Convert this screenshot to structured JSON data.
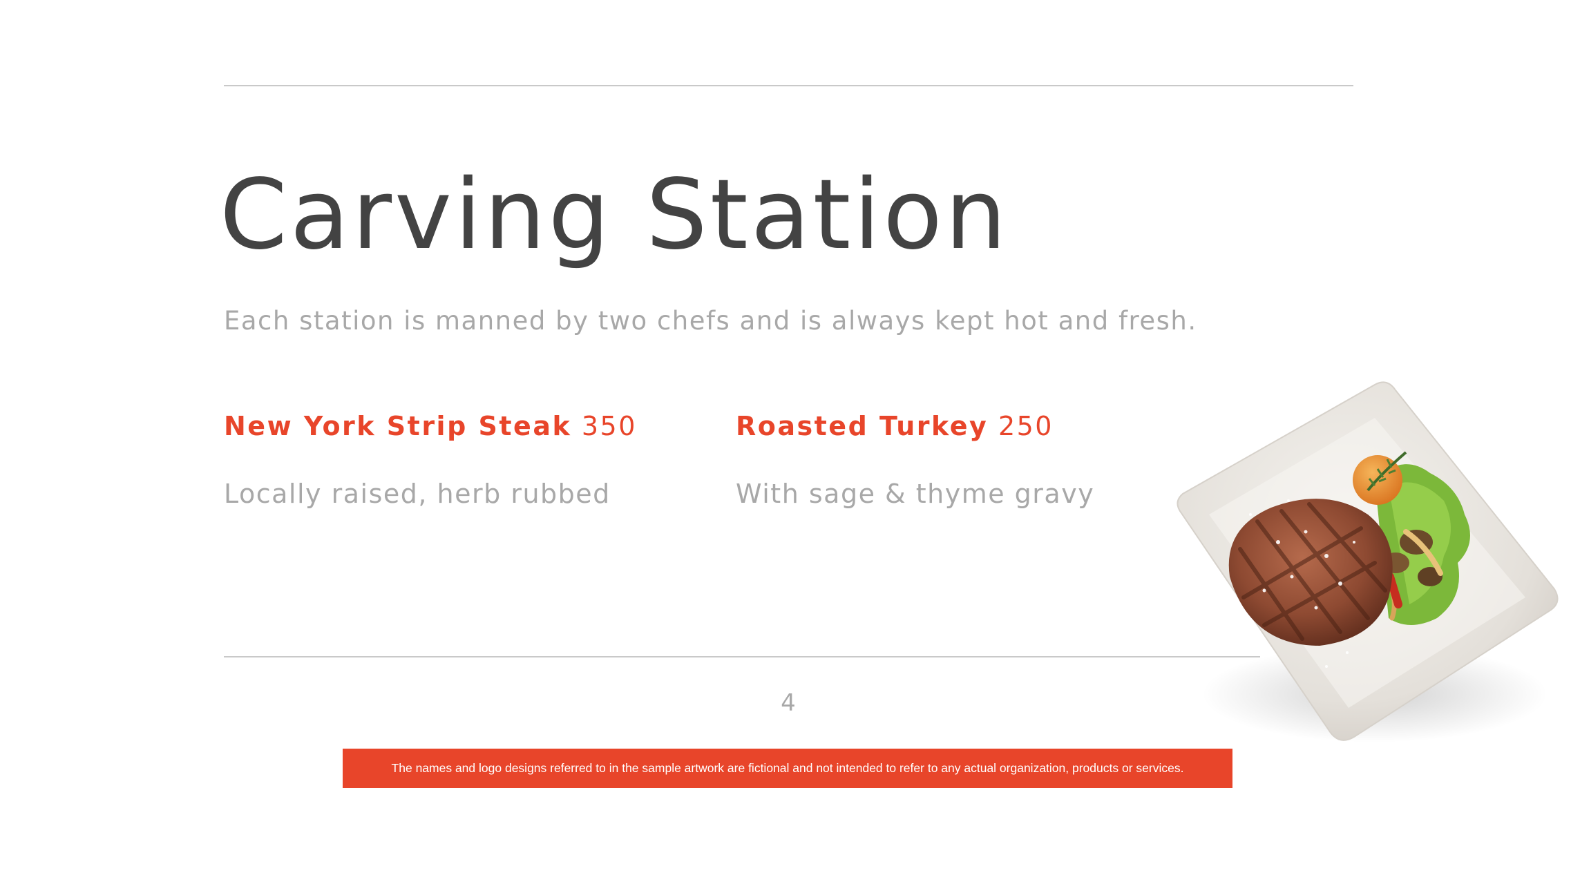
{
  "page": {
    "title": "Carving Station",
    "subtitle": "Each station is manned by two chefs and is always kept hot and fresh.",
    "page_number": "4"
  },
  "menu_items": [
    {
      "name": "New York Strip Steak",
      "price": "350",
      "description": "Locally raised, herb rubbed"
    },
    {
      "name": "Roasted Turkey",
      "price": "250",
      "description": "With sage & thyme gravy"
    }
  ],
  "disclaimer": "The names and logo designs referred to in the sample artwork are fictional and not intended to refer to any actual organization, products or services.",
  "image": {
    "subject": "steak-plate-icon"
  },
  "colors": {
    "accent": "#e8452a",
    "heading": "#434343",
    "muted": "#a8a8a8",
    "rule": "#c9c9c9"
  }
}
